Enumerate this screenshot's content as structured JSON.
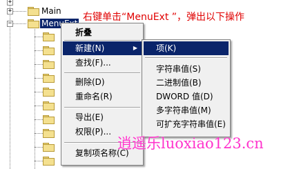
{
  "tree": {
    "expander_symbols": [
      "+",
      "+",
      "−"
    ],
    "items": [
      {
        "label": "Main"
      },
      {
        "label": "MenuExt"
      }
    ]
  },
  "annotation": "右键单击“MenuExt ”，弹出以下操作",
  "context_menu": {
    "items": [
      {
        "label": "折叠"
      },
      {
        "label": "新建(N)",
        "arrow": "▶"
      },
      {
        "label": "查找(F)..."
      },
      {
        "label": "删除(D)"
      },
      {
        "label": "重命名(R)"
      },
      {
        "label": "导出(E)"
      },
      {
        "label": "权限(P)..."
      },
      {
        "label": "复制项名称(C)"
      }
    ]
  },
  "submenu": {
    "items": [
      {
        "label": "项(K)"
      },
      {
        "label": "字符串值(S)"
      },
      {
        "label": "二进制值(B)"
      },
      {
        "label": "DWORD 值(D)"
      },
      {
        "label": "多字符串值(M)"
      },
      {
        "label": "可扩充字符串值(E)"
      }
    ]
  },
  "watermark": "逍遥乐luoxiao123.cn",
  "colors": {
    "selection": "#0a246a",
    "annotation": "#e00000",
    "watermark": "#ff33cc",
    "menu_background": "#f0f0f0"
  }
}
